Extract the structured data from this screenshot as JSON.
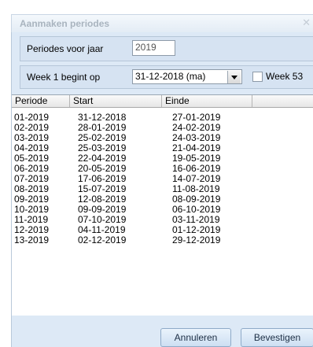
{
  "dialog": {
    "title": "Aanmaken periodes"
  },
  "year": {
    "label": "Periodes voor jaar",
    "value": "2019"
  },
  "week1": {
    "label": "Week 1 begint op",
    "selected": "31-12-2018 (ma)",
    "week53_label": "Week 53",
    "week53_checked": false
  },
  "table": {
    "headers": [
      "Periode",
      "Start",
      "Einde"
    ],
    "rows": [
      [
        "01-2019",
        "31-12-2018",
        "27-01-2019"
      ],
      [
        "02-2019",
        "28-01-2019",
        "24-02-2019"
      ],
      [
        "03-2019",
        "25-02-2019",
        "24-03-2019"
      ],
      [
        "04-2019",
        "25-03-2019",
        "21-04-2019"
      ],
      [
        "05-2019",
        "22-04-2019",
        "19-05-2019"
      ],
      [
        "06-2019",
        "20-05-2019",
        "16-06-2019"
      ],
      [
        "07-2019",
        "17-06-2019",
        "14-07-2019"
      ],
      [
        "08-2019",
        "15-07-2019",
        "11-08-2019"
      ],
      [
        "09-2019",
        "12-08-2019",
        "08-09-2019"
      ],
      [
        "10-2019",
        "09-09-2019",
        "06-10-2019"
      ],
      [
        "11-2019",
        "07-10-2019",
        "03-11-2019"
      ],
      [
        "12-2019",
        "04-11-2019",
        "01-12-2019"
      ],
      [
        "13-2019",
        "02-12-2019",
        "29-12-2019"
      ]
    ]
  },
  "buttons": {
    "cancel": "Annuleren",
    "confirm": "Bevestigen"
  }
}
